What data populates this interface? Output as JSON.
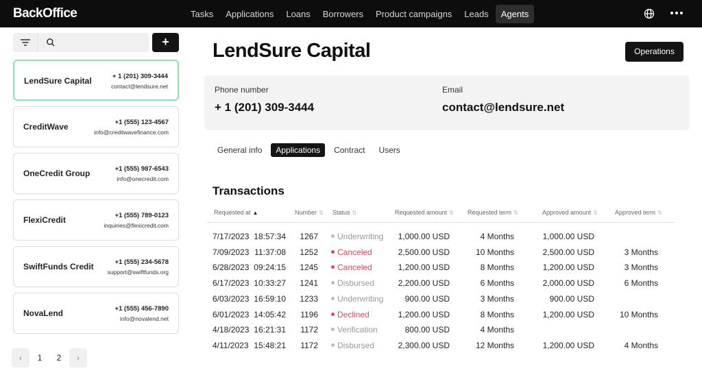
{
  "app": {
    "logo": "BackOffice"
  },
  "nav": [
    {
      "label": "Tasks",
      "active": false
    },
    {
      "label": "Applications",
      "active": false
    },
    {
      "label": "Loans",
      "active": false
    },
    {
      "label": "Borrowers",
      "active": false
    },
    {
      "label": "Product campaigns",
      "active": false
    },
    {
      "label": "Leads",
      "active": false
    },
    {
      "label": "Agents",
      "active": true
    }
  ],
  "toolbar": {
    "add_label": "+"
  },
  "agents": [
    {
      "name": "LendSure Capital",
      "phone": "+ 1 (201) 309-3444",
      "email": "contact@lendsure.net",
      "selected": true
    },
    {
      "name": "CreditWave",
      "phone": "+1 (555) 123-4567",
      "email": "info@creditwavefinance.com",
      "selected": false
    },
    {
      "name": "OneCredit Group",
      "phone": "+1 (555) 987-6543",
      "email": "info@onecredit.com",
      "selected": false
    },
    {
      "name": "FlexiCredit",
      "phone": "+1 (555) 789-0123",
      "email": "inquiries@flexicredit.com",
      "selected": false
    },
    {
      "name": "SwiftFunds Credit",
      "phone": "+1 (555) 234-5678",
      "email": "support@swiftfunds.org",
      "selected": false
    },
    {
      "name": "NovaLend",
      "phone": "+1 (555) 456-7890",
      "email": "info@novalend.net",
      "selected": false
    }
  ],
  "pagination": {
    "prev": "‹",
    "pages": [
      "1",
      "2"
    ],
    "current": "2",
    "next": "›"
  },
  "main": {
    "title": "LendSure Capital",
    "operations_label": "Operations",
    "phone_label": "Phone number",
    "phone_value": "+ 1 (201) 309-3444",
    "email_label": "Email",
    "email_value": "contact@lendsure.net",
    "tabs": [
      {
        "label": "General info",
        "active": false
      },
      {
        "label": "Applications",
        "active": true
      },
      {
        "label": "Contract",
        "active": false
      },
      {
        "label": "Users",
        "active": false
      }
    ],
    "section_title": "Transactions"
  },
  "table": {
    "columns": [
      "Requested at",
      "Number",
      "Status",
      "Requested amount",
      "Requested term",
      "Approved amount",
      "Approved term"
    ],
    "sorted_column": "Requested at",
    "rows": [
      {
        "date": "7/17/2023",
        "time": "18:57:34",
        "number": "1267",
        "status": "Underwriting",
        "status_kind": "gray",
        "req_amount": "1,000.00 USD",
        "req_term": "4 Months",
        "appr_amount": "1,000.00 USD",
        "appr_term": ""
      },
      {
        "date": "7/09/2023",
        "time": "11:37:08",
        "number": "1252",
        "status": "Canceled",
        "status_kind": "red",
        "req_amount": "2,500.00 USD",
        "req_term": "10 Months",
        "appr_amount": "2,500.00 USD",
        "appr_term": "3 Months"
      },
      {
        "date": "6/28/2023",
        "time": "09:24:15",
        "number": "1245",
        "status": "Canceled",
        "status_kind": "red",
        "req_amount": "1,200.00 USD",
        "req_term": "8 Months",
        "appr_amount": "1,200.00 USD",
        "appr_term": "3 Months"
      },
      {
        "date": "6/17/2023",
        "time": "10:33:27",
        "number": "1241",
        "status": "Disbursed",
        "status_kind": "gray",
        "req_amount": "2,200.00 USD",
        "req_term": "6 Months",
        "appr_amount": "2,000.00 USD",
        "appr_term": "6 Months"
      },
      {
        "date": "6/03/2023",
        "time": "16:59:10",
        "number": "1233",
        "status": "Underwriting",
        "status_kind": "gray",
        "req_amount": "900.00 USD",
        "req_term": "3 Months",
        "appr_amount": "900.00 USD",
        "appr_term": ""
      },
      {
        "date": "6/01/2023",
        "time": "14:05:42",
        "number": "1196",
        "status": "Declined",
        "status_kind": "red",
        "req_amount": "1,200.00 USD",
        "req_term": "8 Months",
        "appr_amount": "1,200.00 USD",
        "appr_term": "10 Months"
      },
      {
        "date": "4/18/2023",
        "time": "16:21:31",
        "number": "1172",
        "status": "Verification",
        "status_kind": "gray",
        "req_amount": "800.00 USD",
        "req_term": "4 Months",
        "appr_amount": "",
        "appr_term": ""
      },
      {
        "date": "4/11/2023",
        "time": "15:48:21",
        "number": "1172",
        "status": "Disbursed",
        "status_kind": "gray",
        "req_amount": "2,300.00 USD",
        "req_term": "12 Months",
        "appr_amount": "1,200.00 USD",
        "appr_term": "4 Months"
      }
    ]
  }
}
